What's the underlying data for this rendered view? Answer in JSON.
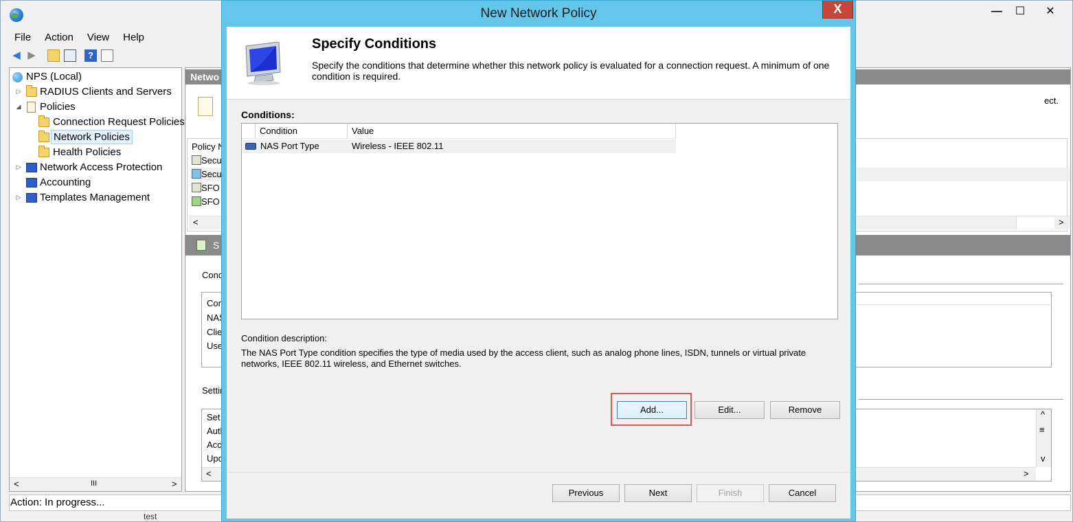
{
  "mmc": {
    "menu": [
      "File",
      "Action",
      "View",
      "Help"
    ],
    "window_controls": {
      "minimize": "—",
      "maximize": "☐",
      "close": "✕"
    },
    "tree": {
      "root": "NPS (Local)",
      "radius": "RADIUS Clients and Servers",
      "policies": "Policies",
      "connection_request": "Connection Request Policies",
      "network_policies": "Network Policies",
      "health_policies": "Health Policies",
      "nap": "Network Access Protection",
      "accounting": "Accounting",
      "templates": "Templates Management"
    },
    "tree_scroll": {
      "left": "<",
      "thumb": "III",
      "right": ">"
    },
    "right_header": "Netwo",
    "right_desc": "ect.",
    "policy_list": {
      "header": "Policy N",
      "rows": [
        "Secu",
        "Secu",
        "SFO",
        "SFO"
      ]
    },
    "policy_scroll": {
      "left": "<",
      "right": ">"
    },
    "band_text": "S",
    "conditions_section": "Cond",
    "conditions_box_rows": [
      "Con",
      "NAS",
      "Clie",
      "Use"
    ],
    "settings_section": "Settir",
    "settings_box_rows": [
      "Set",
      "Auth",
      "Acc",
      "Upd"
    ],
    "settings_scroll": {
      "up": "^",
      "down": "v",
      "left": "<",
      "right": ">",
      "thumb": "≡"
    },
    "status": "Action:  In progress...",
    "bottom_peek": "test"
  },
  "dialog": {
    "title": "New Network Policy",
    "close": "X",
    "heading": "Specify Conditions",
    "subtext": "Specify the conditions that determine whether this network policy is evaluated for a connection request. A minimum of one condition is required.",
    "conditions_label": "Conditions:",
    "columns": [
      "Condition",
      "Value"
    ],
    "rows": [
      {
        "condition": "NAS Port Type",
        "value": "Wireless - IEEE 802.11"
      }
    ],
    "description_label": "Condition description:",
    "description": "The NAS Port Type condition specifies the type of media used by the access client, such as analog phone lines, ISDN, tunnels or virtual private networks, IEEE 802.11 wireless, and Ethernet switches.",
    "buttons": {
      "add": "Add...",
      "edit": "Edit...",
      "remove": "Remove",
      "previous": "Previous",
      "next": "Next",
      "finish": "Finish",
      "cancel": "Cancel"
    },
    "colors": {
      "title_bar": "#63c6ea",
      "close_button": "#c7463b",
      "highlight": "#e05555"
    }
  }
}
